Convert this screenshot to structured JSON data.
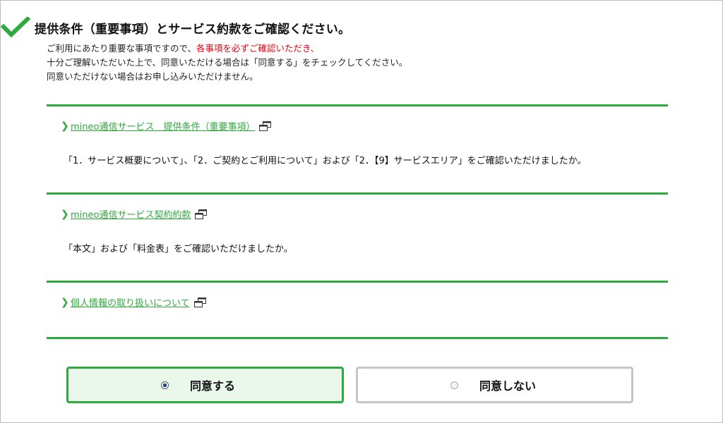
{
  "header": {
    "title": "提供条件（重要事項）とサービス約款をご確認ください。"
  },
  "intro": {
    "line1_prefix": "ご利用にあたり重要な事項ですので、",
    "line1_warning": "各事項を必ずご確認いただき、",
    "line2": "十分ご理解いただいた上で、同意いただける場合は「同意する」をチェックしてください。",
    "line3": "同意いただけない場合はお申し込みいただけません。"
  },
  "sections": [
    {
      "link": "mineo通信サービス　提供条件（重要事項）",
      "question": "「1．サービス概要について」、「2．ご契約とご利用について」および「2．【9】サービスエリア」をご確認いただけましたか。"
    },
    {
      "link": "mineo通信サービス契約約款",
      "question": "「本文」および「料金表」をご確認いただけましたか。"
    },
    {
      "link": "個人情報の取り扱いについて",
      "question": ""
    }
  ],
  "consent": {
    "agree_label": "同意する",
    "disagree_label": "同意しない",
    "selected": "agree"
  },
  "colors": {
    "accent": "#2eaa3c",
    "warning": "#e60012",
    "selected_bg": "#e9f8eb",
    "unselected_border": "#c6c6c6"
  }
}
